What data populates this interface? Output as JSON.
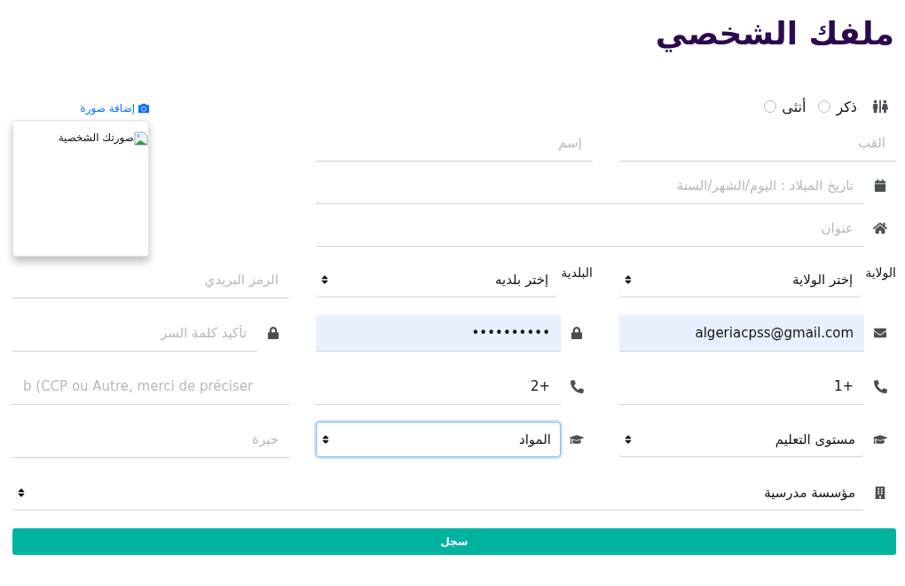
{
  "title": "ملفك الشخصي",
  "gender": {
    "options": [
      {
        "label": "ذكر",
        "selected": false
      },
      {
        "label": "أنثى",
        "selected": false
      }
    ]
  },
  "photo": {
    "link": "إضافة صورة",
    "alt": "صورتك الشخصية"
  },
  "top_rows": [
    [
      {
        "kind": "name",
        "placeholder": "القب"
      },
      {
        "kind": "name",
        "placeholder": "إسم"
      }
    ],
    [
      {
        "kind": "date",
        "placeholder": "تاريخ الميلاد : اليوم/الشهر/السنة"
      }
    ],
    [
      {
        "kind": "address",
        "placeholder": "عنوان"
      }
    ]
  ],
  "rows": [
    [
      {
        "kind": "place",
        "label": "الولاية",
        "value": "إختر الولاية"
      },
      {
        "kind": "place",
        "label": "البلدية",
        "value": "إختر بلديه"
      },
      {
        "kind": "plain",
        "placeholder": "الرمز البريدي"
      }
    ],
    [
      {
        "kind": "email",
        "value": "algeriacpss@gmail.com",
        "autofilled": true
      },
      {
        "kind": "password",
        "value": "••••••••••",
        "autofilled": true
      },
      {
        "kind": "password",
        "placeholder": "تأكيد كلمة السر",
        "autofilled": false
      }
    ],
    [
      {
        "kind": "phone",
        "value": "+1"
      },
      {
        "kind": "phone",
        "value": "+2"
      },
      {
        "kind": "latin",
        "placeholder": "b (CCP ou Autre, merci de préciser"
      }
    ],
    [
      {
        "kind": "study",
        "value": "مستوى التعليم",
        "focused": false
      },
      {
        "kind": "study",
        "value": "المواد",
        "focused": true
      },
      {
        "kind": "plain",
        "placeholder": "خبرة"
      }
    ],
    [
      {
        "kind": "school",
        "value": "مؤسسة مدرسية"
      }
    ]
  ],
  "submit": "سجل"
}
